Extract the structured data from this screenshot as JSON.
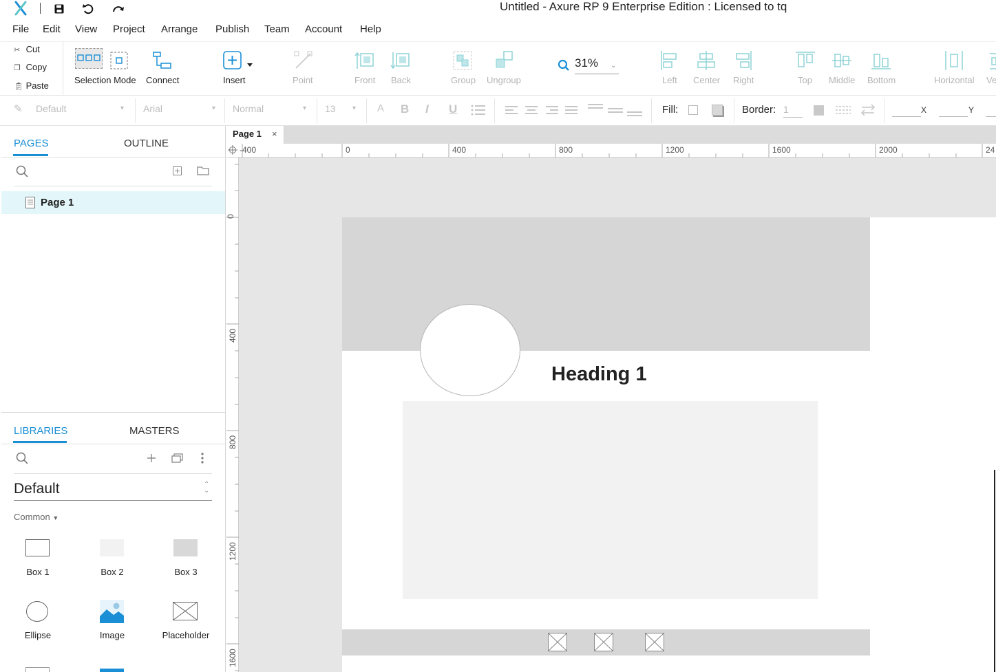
{
  "window": {
    "title": "Untitled - Axure RP 9 Enterprise Edition : Licensed to tq"
  },
  "menu": [
    "File",
    "Edit",
    "View",
    "Project",
    "Arrange",
    "Publish",
    "Team",
    "Account",
    "Help"
  ],
  "clipboard": {
    "cut": "Cut",
    "copy": "Copy",
    "paste": "Paste"
  },
  "toolbar": {
    "selection_mode": "Selection Mode",
    "connect": "Connect",
    "insert": "Insert",
    "point": "Point",
    "front": "Front",
    "back": "Back",
    "group": "Group",
    "ungroup": "Ungroup",
    "zoom": "31%",
    "align_left": "Left",
    "align_center": "Center",
    "align_right": "Right",
    "align_top": "Top",
    "align_middle": "Middle",
    "align_bottom": "Bottom",
    "distribute_horizontal": "Horizontal",
    "distribute_vertical_partial": "Ve"
  },
  "format": {
    "style": "Default",
    "font": "Arial",
    "weight": "Normal",
    "size": "13",
    "fill_label": "Fill:",
    "border_label": "Border:",
    "border_value": "1",
    "x_label": "X",
    "y_label": "Y"
  },
  "pages_panel": {
    "tab_pages": "PAGES",
    "tab_outline": "OUTLINE",
    "pages": [
      "Page 1"
    ]
  },
  "libraries_panel": {
    "tab_libraries": "LIBRARIES",
    "tab_masters": "MASTERS",
    "library_name": "Default",
    "section": "Common",
    "items": [
      "Box 1",
      "Box 2",
      "Box 3",
      "Ellipse",
      "Image",
      "Placeholder"
    ]
  },
  "document": {
    "tab": "Page 1",
    "ruler_h": [
      "-400",
      "0",
      "400",
      "800",
      "1200",
      "1600",
      "2000",
      "24"
    ],
    "ruler_v": [
      "0",
      "400",
      "800",
      "1200",
      "1600"
    ],
    "heading": "Heading 1"
  },
  "colors": {
    "accent": "#1a8fd6",
    "canvas_bg": "#e6e6e6",
    "selected_page_bg": "#e3f7fa",
    "header_band": "#d6d6d6",
    "content_box": "#f2f2f2",
    "icon_teal": "#5bc4c9"
  }
}
